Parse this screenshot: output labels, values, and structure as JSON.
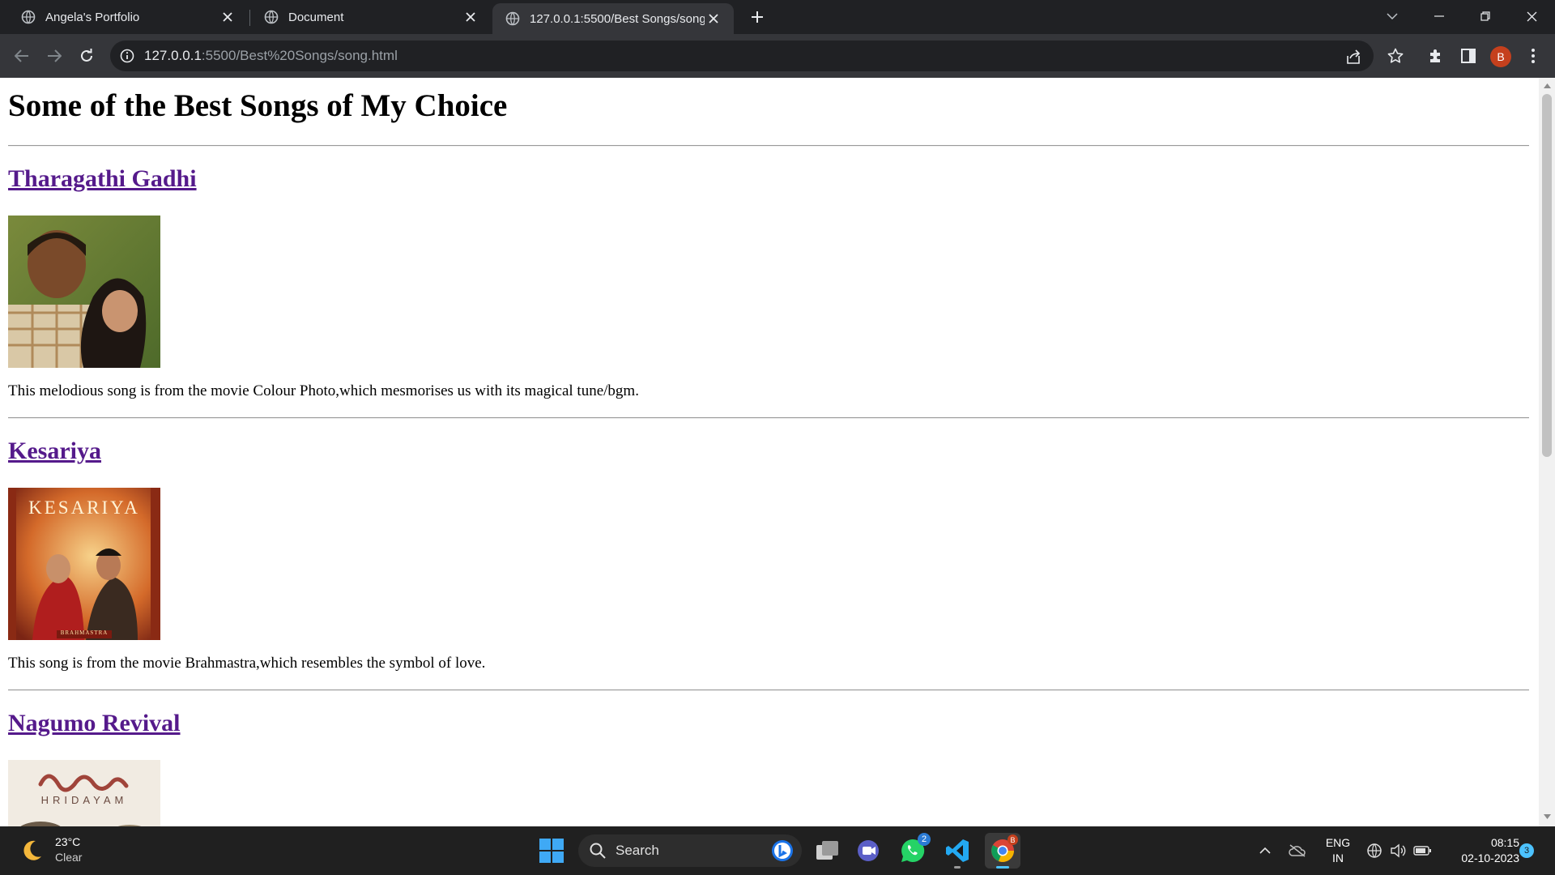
{
  "browser": {
    "tabs": [
      {
        "title": "Angela's Portfolio",
        "active": false
      },
      {
        "title": "Document",
        "active": false
      },
      {
        "title": "127.0.0.1:5500/Best Songs/song.html",
        "active": true
      }
    ],
    "url_host": "127.0.0.1",
    "url_rest": ":5500/Best%20Songs/song.html",
    "profile_initial": "B"
  },
  "page": {
    "title": "Some of the Best Songs of My Choice",
    "songs": [
      {
        "name": "Tharagathi Gadhi",
        "description": "This melodious song is from the movie Colour Photo,which mesmorises us with its magical tune/bgm.",
        "image_icon": "song-cover-photo"
      },
      {
        "name": "Kesariya",
        "description": "This song is from the movie Brahmastra,which resembles the symbol of love.",
        "image_icon": "song-cover-photo",
        "image_text": "KESARIYA",
        "image_subtext": "BRAHMASTRA"
      },
      {
        "name": "Nagumo Revival",
        "image_icon": "song-cover-photo",
        "image_text": "HRIDAYAM"
      }
    ]
  },
  "taskbar": {
    "weather_temp": "23°C",
    "weather_desc": "Clear",
    "search_label": "Search",
    "whatsapp_badge": "2",
    "chrome_badge": "B",
    "language_line1": "ENG",
    "language_line2": "IN",
    "time": "08:15",
    "date": "02-10-2023",
    "notification_count": "3"
  }
}
